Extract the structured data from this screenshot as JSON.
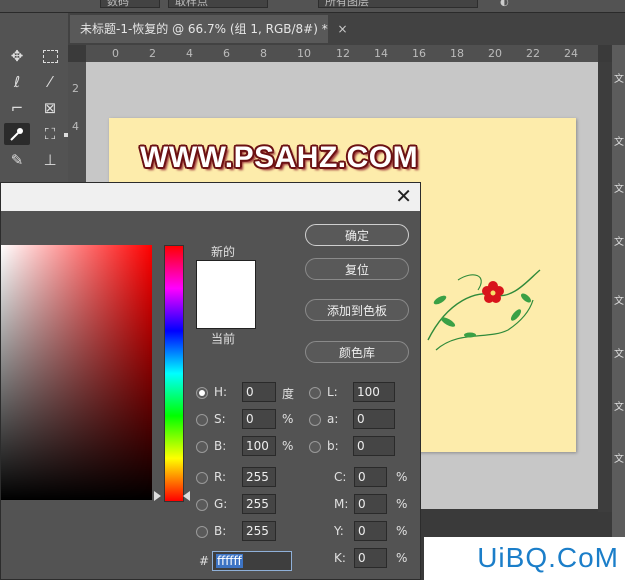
{
  "options_bar": {
    "field1": "数码",
    "field2": "取样点",
    "field3": "所有图层"
  },
  "document": {
    "tab_title": "未标题-1-恢复的 @ 66.7% (组 1, RGB/8#) *",
    "close": "×"
  },
  "ruler": {
    "top_ticks": [
      "0",
      "2",
      "4",
      "6",
      "8",
      "10",
      "12",
      "14",
      "16",
      "18",
      "20",
      "22",
      "24"
    ],
    "left_ticks": [
      "2",
      "4"
    ]
  },
  "canvas": {
    "watermark_text": "WWW.PSAHZ.COM",
    "background_color": "#fdecab"
  },
  "right_panel_glyphs": [
    "文",
    "文",
    "文",
    "文",
    "文",
    "文",
    "文",
    "文"
  ],
  "color_picker": {
    "new_label": "新的",
    "current_label": "当前",
    "buttons": {
      "ok": "确定",
      "reset": "复位",
      "add_swatch": "添加到色板",
      "libraries": "颜色库"
    },
    "hsb": [
      {
        "label": "H:",
        "value": "0",
        "unit": "度",
        "selected": true
      },
      {
        "label": "S:",
        "value": "0",
        "unit": "%",
        "selected": false
      },
      {
        "label": "B:",
        "value": "100",
        "unit": "%",
        "selected": false
      }
    ],
    "lab": [
      {
        "label": "L:",
        "value": "100"
      },
      {
        "label": "a:",
        "value": "0"
      },
      {
        "label": "b:",
        "value": "0"
      }
    ],
    "rgb": [
      {
        "label": "R:",
        "value": "255"
      },
      {
        "label": "G:",
        "value": "255"
      },
      {
        "label": "B:",
        "value": "255"
      }
    ],
    "cmyk": [
      {
        "label": "C:",
        "value": "0",
        "unit": "%"
      },
      {
        "label": "M:",
        "value": "0",
        "unit": "%"
      },
      {
        "label": "Y:",
        "value": "0",
        "unit": "%"
      },
      {
        "label": "K:",
        "value": "0",
        "unit": "%"
      }
    ],
    "hex_label": "#",
    "hex_value": "ffffff",
    "new_color": "#ffffff",
    "current_color": "#ffffff"
  },
  "site_watermark": "UiBQ.CoM"
}
